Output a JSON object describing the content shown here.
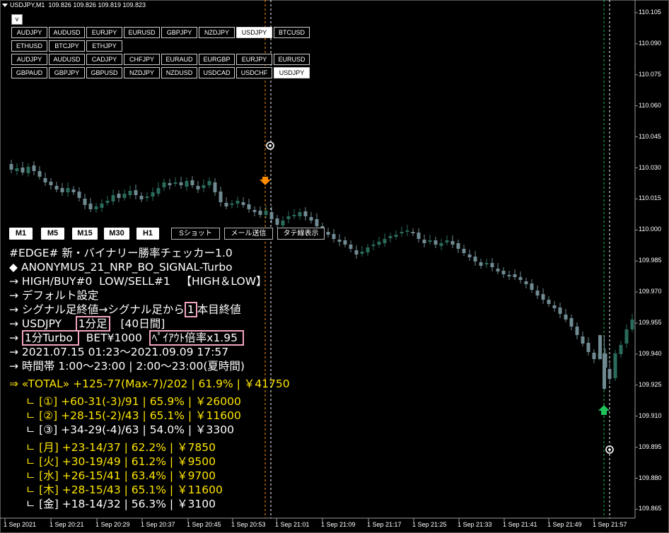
{
  "header": {
    "symbol": "USDJPY,M1",
    "ohlc": "109.826 109.826 109.819 109.823"
  },
  "toolbar": {
    "v_label": "v"
  },
  "pair_rows": [
    [
      "AUDJPY",
      "AUDUSD",
      "EURJPY",
      "EURUSD",
      "GBPJPY",
      "NZDJPY",
      "USDJPY",
      "BTCUSD"
    ],
    [
      "ETHUSD",
      "BTCJPY",
      "ETHJPY"
    ],
    [
      "AUDJPY",
      "AUDUSD",
      "CADJPY",
      "CHFJPY",
      "EURAUD",
      "EURGBP",
      "EURJPY",
      "EURUSD"
    ],
    [
      "GBPAUD",
      "GBPJPY",
      "GBPUSD",
      "NZDJPY",
      "NZDUSD",
      "USDCAD",
      "USDCHF",
      "USDJPY"
    ]
  ],
  "selected_pairs": {
    "row0": "USDJPY",
    "row3": "USDJPY"
  },
  "timeframes": [
    "M1",
    "M5",
    "M15",
    "M30",
    "H1"
  ],
  "tools": [
    "Sショット",
    "メール送信",
    "タテ線表示"
  ],
  "info": {
    "l1": "#EDGE# 新・バイナリー勝率チェッカー1.0",
    "l2": "◆ ANONYMUS_21_NRP_BO_SIGNAL-Turbo",
    "l3": "→ HIGH/BUY#0  LOW/SELL#1   【HIGH＆LOW】",
    "l4": "→ デフォルト設定",
    "l5a": "→ シグナル足終値→シグナル足から",
    "l5b": "1",
    "l5c": "本目終値",
    "l6a": "→ USDJPY    ",
    "l6b": "1分足",
    "l6c": "   [40日間]",
    "l7a": "→ ",
    "l7b": "1分Turbo ",
    "l7c": "  BET¥1000  ",
    "l7d": "ﾍﾟｲｱｳﾄ倍率x1.95 ",
    "l8": "→ 2021.07.15 01:23～2021.09.09 17:57",
    "l9": "→ 時間帯 1:00～23:00 | 2:00～23:00(夏時間)",
    "total": "⇒ «TOTAL» +125-77(Max-7)/202 | 61.9% | ￥41750",
    "s1": "ㄴ [①] +60-31(-3)/91 | 65.9% | ￥26000",
    "s2": "ㄴ [②] +28-15(-2)/43 | 65.1% | ￥11600",
    "s3": "ㄴ [③] +34-29(-4)/63 | 54.0% | ￥3300",
    "d1": "ㄴ [月] +23-14/37 | 62.2% | ￥7850",
    "d2": "ㄴ [火] +30-19/49 | 61.2% | ￥9500",
    "d3": "ㄴ [水] +26-15/41 | 63.4% | ￥9700",
    "d4": "ㄴ [木] +28-15/43 | 65.1% | ￥11600",
    "d5": "ㄴ [金] +18-14/32 | 56.3% | ￥3100"
  },
  "price_axis": [
    "110.105",
    "110.090",
    "110.075",
    "110.060",
    "110.045",
    "110.030",
    "110.015",
    "110.000",
    "109.985",
    "109.970",
    "109.955",
    "109.940",
    "109.925",
    "109.910",
    "109.895",
    "109.880",
    "109.865"
  ],
  "time_axis": [
    "1 Sep 2021",
    "1 Sep 20:21",
    "1 Sep 20:29",
    "1 Sep 20:37",
    "1 Sep 20:45",
    "1 Sep 20:53",
    "1 Sep 21:01",
    "1 Sep 21:09",
    "1 Sep 21:17",
    "1 Sep 21:25",
    "1 Sep 21:33",
    "1 Sep 21:41",
    "1 Sep 21:49",
    "1 Sep 21:57"
  ],
  "colors": {
    "up_candle": "#2a6b5c",
    "down_candle": "#708a92",
    "signal_sell": "#ff8c00",
    "signal_buy": "#1fc35a",
    "text_white": "#ffffff",
    "text_yellow": "#ffe600",
    "highlight_box": "#f2a6c0"
  },
  "icons": {
    "sell_signal": "arrow-down-icon",
    "buy_signal": "arrow-up-icon",
    "result_marker": "target-circle-icon"
  }
}
